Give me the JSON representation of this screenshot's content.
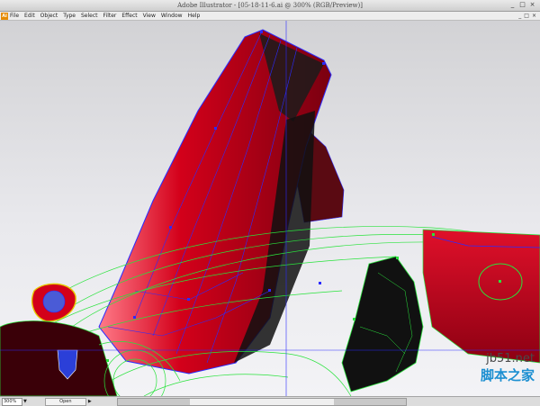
{
  "window": {
    "title": "Adobe Illustrator - [05-18-11-6.ai @ 300% (RGB/Preview)]",
    "controls": [
      "_",
      "□",
      "×"
    ]
  },
  "menubar": {
    "logo": "Ai",
    "items": [
      "File",
      "Edit",
      "Object",
      "Type",
      "Select",
      "Filter",
      "Effect",
      "View",
      "Window",
      "Help"
    ],
    "doc_controls": [
      "_",
      "□",
      "×"
    ]
  },
  "statusbar": {
    "zoom": "300%",
    "status": "Open"
  },
  "watermark": {
    "domain": "jb51.net",
    "name": "脚本之家"
  },
  "colors": {
    "car_red": "#d3001a",
    "path_blue": "#2b2bff",
    "path_green": "#29e33c",
    "shadow": "#1b1b1b",
    "watermark_blue": "#1c8fd1"
  },
  "icons": {
    "app": "illustrator-logo-icon",
    "zoom_dropdown": "chevron-down-icon"
  }
}
